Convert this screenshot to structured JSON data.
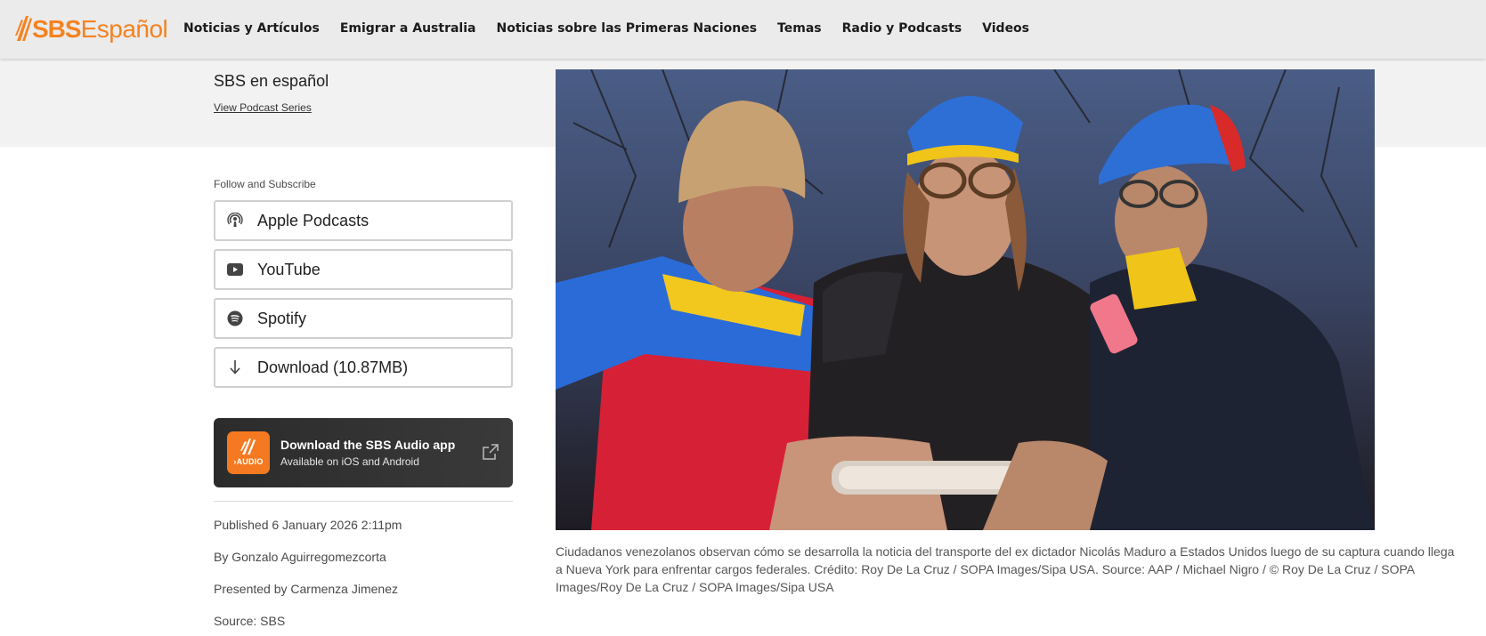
{
  "brand": {
    "logo_sbs": "SBS",
    "logo_espanol": "Español",
    "accent_color": "#f5821f"
  },
  "nav": {
    "items": [
      {
        "label": "Noticias y Artículos"
      },
      {
        "label": "Emigrar a Australia"
      },
      {
        "label": "Noticias sobre las Primeras Naciones"
      },
      {
        "label": "Temas"
      },
      {
        "label": "Radio y Podcasts"
      },
      {
        "label": "Videos"
      }
    ]
  },
  "series": {
    "title": "SBS en español",
    "link": "View Podcast Series"
  },
  "subscribe": {
    "label": "Follow and Subscribe",
    "buttons": [
      {
        "label": "Apple Podcasts",
        "icon": "podcast-icon"
      },
      {
        "label": "YouTube",
        "icon": "youtube-icon"
      },
      {
        "label": "Spotify",
        "icon": "spotify-icon"
      },
      {
        "label": "Download (10.87MB)",
        "icon": "download-icon"
      }
    ]
  },
  "app_promo": {
    "icon_text": "›AUDIO",
    "title": "Download the SBS Audio app",
    "subtitle": "Available on iOS and Android"
  },
  "meta": {
    "published": "Published 6 January 2026 2:11pm",
    "author": "By Gonzalo Aguirregomezcorta",
    "presenter": "Presented by Carmenza Jimenez",
    "source": "Source: SBS"
  },
  "photo": {
    "caption": "Ciudadanos venezolanos observan cómo se desarrolla la noticia del transporte del ex dictador Nicolás Maduro a Estados Unidos luego de su captura cuando llega a Nueva York para enfrentar cargos federales. Crédito: Roy De La Cruz / SOPA Images/Sipa USA. Source: AAP / Michael Nigro / © Roy De La Cruz / SOPA Images/Roy De La Cruz / SOPA Images/Sipa USA"
  }
}
